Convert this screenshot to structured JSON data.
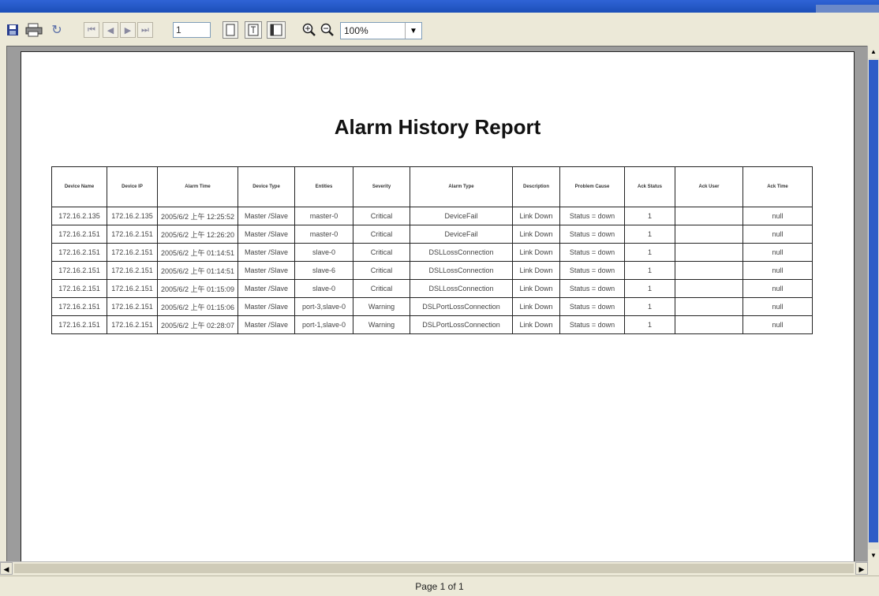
{
  "toolbar": {
    "page_number": "1",
    "zoom": "100%"
  },
  "report": {
    "title": "Alarm History Report",
    "columns": [
      "Device Name",
      "Device IP",
      "Alarm Time",
      "Device Type",
      "Entities",
      "Severity",
      "Alarm Type",
      "Description",
      "Problem Cause",
      "Ack Status",
      "Ack User",
      "Ack Time"
    ],
    "rows": [
      [
        "172.16.2.135",
        "172.16.2.135",
        "2005/6/2 上午 12:25:52",
        "Master /Slave",
        "master-0",
        "Critical",
        "DeviceFail",
        "Link Down",
        "Status = down",
        "1",
        "",
        "null"
      ],
      [
        "172.16.2.151",
        "172.16.2.151",
        "2005/6/2 上午 12:26:20",
        "Master /Slave",
        "master-0",
        "Critical",
        "DeviceFail",
        "Link Down",
        "Status = down",
        "1",
        "",
        "null"
      ],
      [
        "172.16.2.151",
        "172.16.2.151",
        "2005/6/2 上午 01:14:51",
        "Master /Slave",
        "slave-0",
        "Critical",
        "DSLLossConnection",
        "Link Down",
        "Status = down",
        "1",
        "",
        "null"
      ],
      [
        "172.16.2.151",
        "172.16.2.151",
        "2005/6/2 上午 01:14:51",
        "Master /Slave",
        "slave-6",
        "Critical",
        "DSLLossConnection",
        "Link Down",
        "Status = down",
        "1",
        "",
        "null"
      ],
      [
        "172.16.2.151",
        "172.16.2.151",
        "2005/6/2 上午 01:15:09",
        "Master /Slave",
        "slave-0",
        "Critical",
        "DSLLossConnection",
        "Link Down",
        "Status = down",
        "1",
        "",
        "null"
      ],
      [
        "172.16.2.151",
        "172.16.2.151",
        "2005/6/2 上午 01:15:06",
        "Master /Slave",
        "port-3,slave-0",
        "Warning",
        "DSLPortLossConnection",
        "Link Down",
        "Status = down",
        "1",
        "",
        "null"
      ],
      [
        "172.16.2.151",
        "172.16.2.151",
        "2005/6/2 上午 02:28:07",
        "Master /Slave",
        "port-1,slave-0",
        "Warning",
        "DSLPortLossConnection",
        "Link Down",
        "Status = down",
        "1",
        "",
        "null"
      ]
    ]
  },
  "status": {
    "page_indicator": "Page 1 of 1"
  },
  "colors": {
    "accent": "#2e5cc7",
    "chrome": "#ece9d8"
  }
}
